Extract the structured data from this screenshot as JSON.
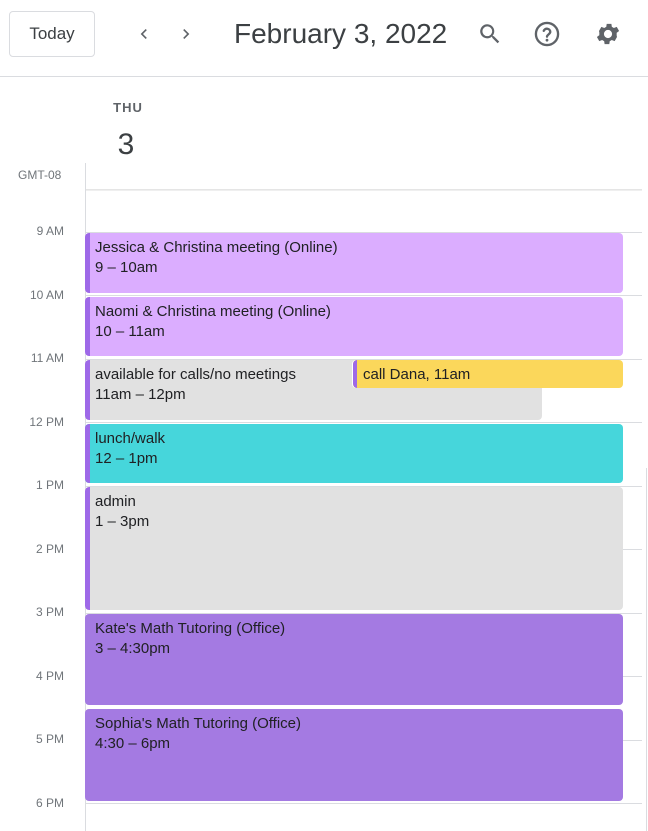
{
  "header": {
    "today_label": "Today",
    "date_title": "February 3, 2022",
    "prev_icon": "chevron-left-icon",
    "next_icon": "chevron-right-icon",
    "search_icon": "search-icon",
    "help_icon": "help-icon",
    "settings_icon": "gear-icon"
  },
  "day": {
    "name": "THU",
    "number": "3"
  },
  "timezone": "GMT-08",
  "hours": [
    "9 AM",
    "10 AM",
    "11 AM",
    "12 PM",
    "1 PM",
    "2 PM",
    "3 PM",
    "4 PM",
    "5 PM",
    "6 PM"
  ],
  "events": [
    {
      "title": "Jessica & Christina meeting (Online)",
      "time": "9 – 10am"
    },
    {
      "title": "Naomi & Christina meeting (Online)",
      "time": "10 – 11am"
    },
    {
      "title": "available for calls/no meetings",
      "time": "11am – 12pm"
    },
    {
      "title": "call Dana",
      "time": ", 11am"
    },
    {
      "title": "lunch/walk",
      "time": "12 – 1pm"
    },
    {
      "title": "admin",
      "time": "1 – 3pm"
    },
    {
      "title": "Kate's Math Tutoring (Office)",
      "time": "3 – 4:30pm"
    },
    {
      "title": "Sophia's Math Tutoring (Office)",
      "time": "4:30 – 6pm"
    }
  ],
  "colors": {
    "lavender": "#dbadff",
    "gray": "#e1e1e1",
    "cyan": "#46d6db",
    "purple": "#a47ae2",
    "yellow": "#fbd75b",
    "stripe": "#9e69e8"
  }
}
